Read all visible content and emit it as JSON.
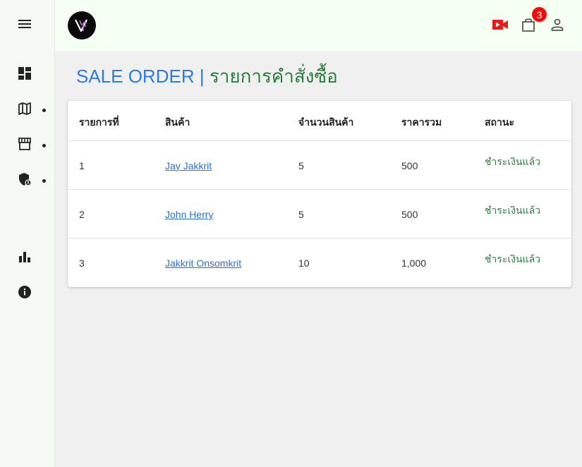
{
  "page": {
    "title_en": "SALE ORDER | ",
    "title_th": "รายการคำสั่งซื้อ"
  },
  "header": {
    "cart_count": "3"
  },
  "table": {
    "columns": [
      "รายการที่",
      "สินค้า",
      "จำนวนสินค้า",
      "ราคารวม",
      "สถานะ"
    ],
    "rows": [
      {
        "no": "1",
        "product": "Jay Jakkrit",
        "qty": "5",
        "total": "500",
        "status": "ชำระเงินแล้ว"
      },
      {
        "no": "2",
        "product": "John Herry",
        "qty": "5",
        "total": "500",
        "status": "ชำระเงินแล้ว"
      },
      {
        "no": "3",
        "product": "Jakkrit Onsomkrit",
        "qty": "10",
        "total": "1,000",
        "status": "ชำระเงินแล้ว"
      }
    ]
  },
  "colors": {
    "accent_blue": "#2c7be0",
    "accent_green": "#2a7d3a",
    "badge_red": "#f20d0d",
    "video_red": "#e81b1b"
  },
  "icons": {
    "sidebar": [
      "menu-icon",
      "dashboard-icon",
      "map-icon",
      "store-icon",
      "admin-shield-icon",
      "bar-chart-icon",
      "info-icon"
    ],
    "header": [
      "video-icon",
      "shopping-bag-icon",
      "person-icon"
    ]
  }
}
